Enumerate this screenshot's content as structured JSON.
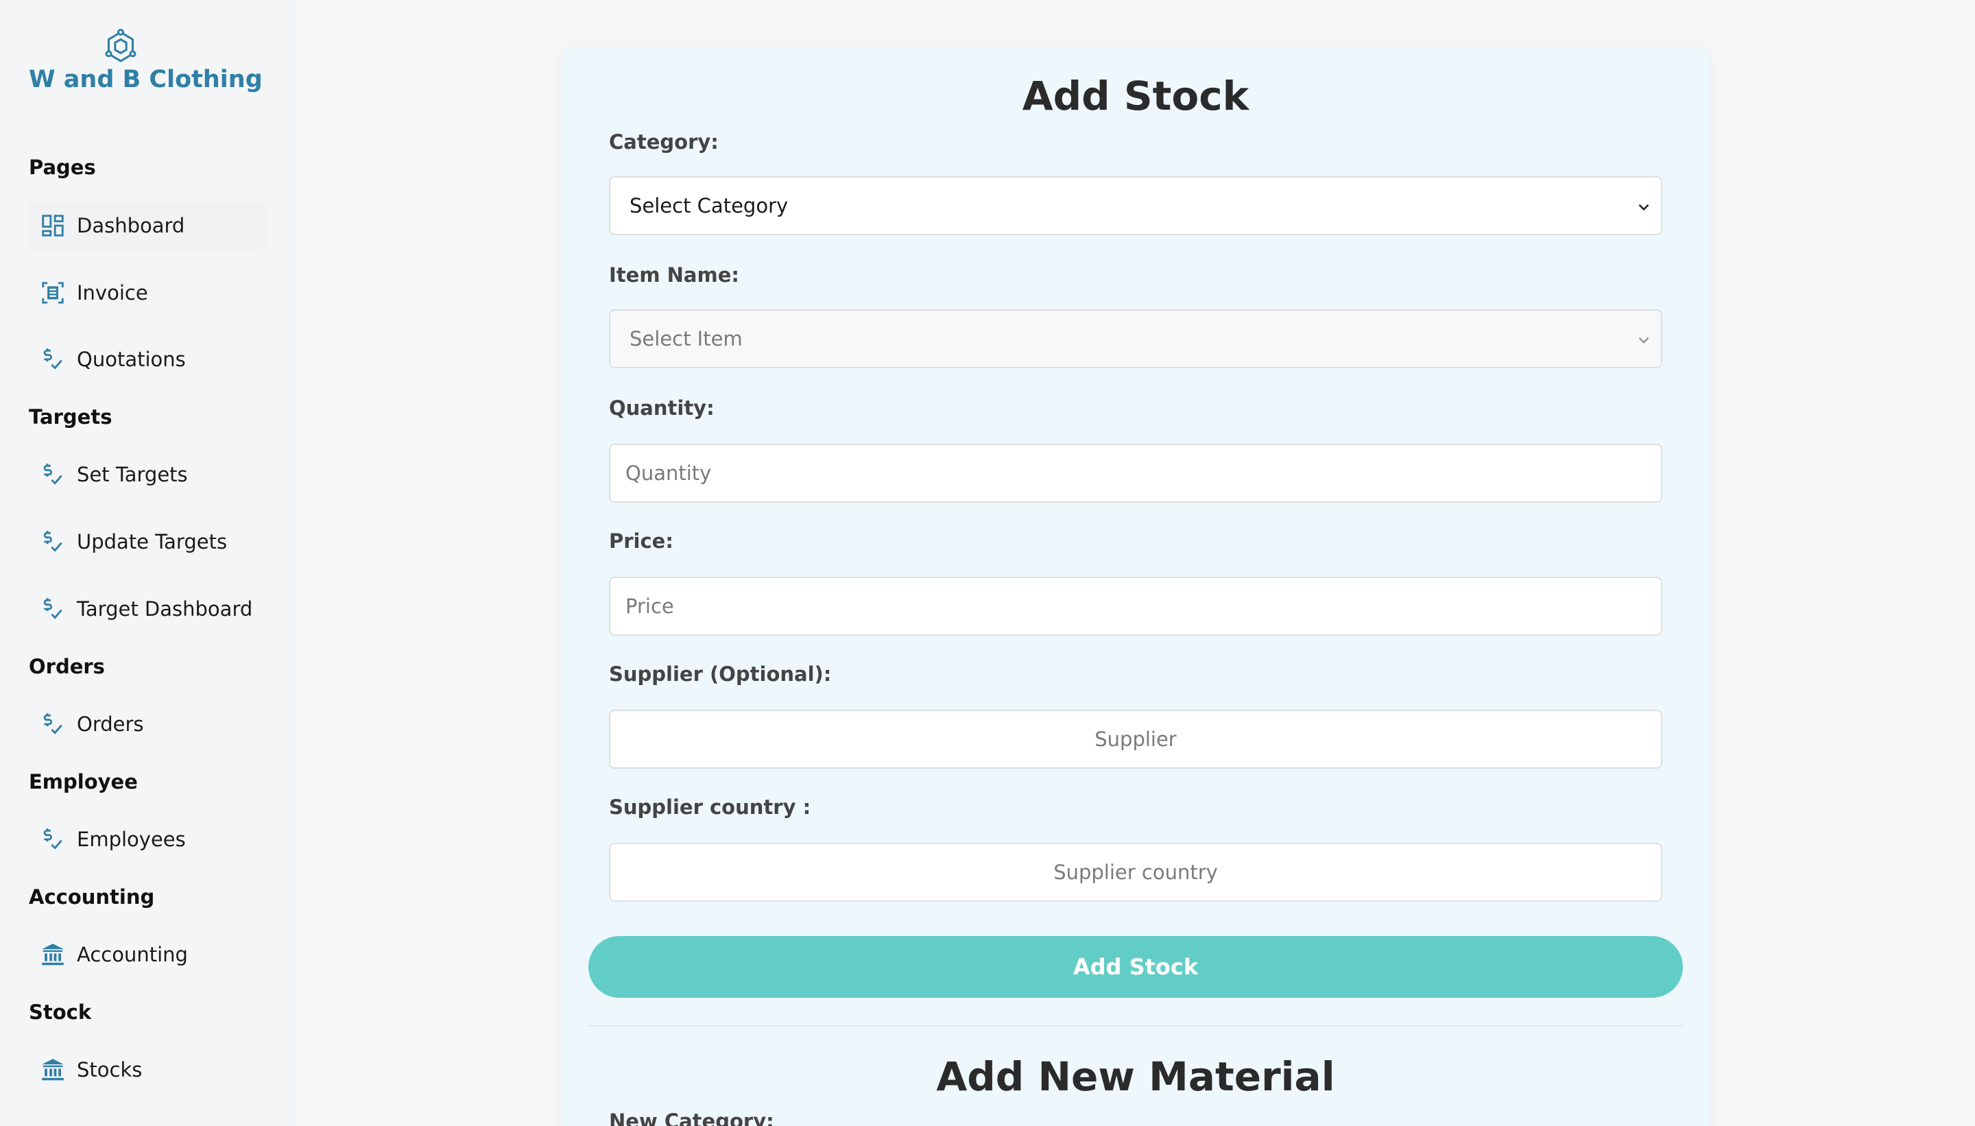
{
  "brand": {
    "name": "W and B Clothing",
    "logo_icon": "hexagon-logo-icon"
  },
  "colors": {
    "brand": "#2f7fa6",
    "button": "#62cdc6",
    "card_bg": "#eef8fc"
  },
  "sidebar": {
    "sections": [
      {
        "title": "Pages",
        "items": [
          {
            "label": "Dashboard",
            "icon": "dashboard-icon"
          },
          {
            "label": "Invoice",
            "icon": "invoice-icon"
          },
          {
            "label": "Quotations",
            "icon": "dollar-check-icon"
          }
        ]
      },
      {
        "title": "Targets",
        "items": [
          {
            "label": "Set Targets",
            "icon": "dollar-check-icon"
          },
          {
            "label": "Update Targets",
            "icon": "dollar-check-icon"
          },
          {
            "label": "Target Dashboard",
            "icon": "dollar-check-icon"
          }
        ]
      },
      {
        "title": "Orders",
        "items": [
          {
            "label": "Orders",
            "icon": "dollar-check-icon"
          }
        ]
      },
      {
        "title": "Employee",
        "items": [
          {
            "label": "Employees",
            "icon": "dollar-check-icon"
          }
        ]
      },
      {
        "title": "Accounting",
        "items": [
          {
            "label": "Accounting",
            "icon": "bank-icon"
          }
        ]
      },
      {
        "title": "Stock",
        "items": [
          {
            "label": "Stocks",
            "icon": "bank-icon"
          }
        ]
      }
    ]
  },
  "form": {
    "title": "Add Stock",
    "category": {
      "label": "Category:",
      "value": "Select Category"
    },
    "item_name": {
      "label": "Item Name:",
      "value": "Select Item"
    },
    "quantity": {
      "label": "Quantity:",
      "placeholder": "Quantity"
    },
    "price": {
      "label": "Price:",
      "placeholder": "Price"
    },
    "supplier": {
      "label": "Supplier (Optional):",
      "placeholder": "Supplier"
    },
    "supplier_country": {
      "label": "Supplier country :",
      "placeholder": "Supplier country"
    },
    "submit_label": "Add Stock"
  },
  "material_form": {
    "title": "Add New Material",
    "new_category_label": "New Category:"
  }
}
